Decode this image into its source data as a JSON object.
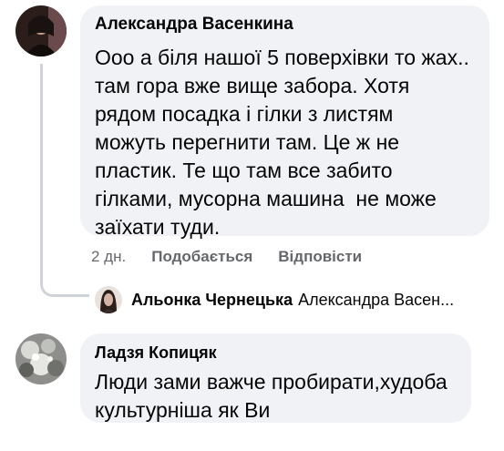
{
  "comments": [
    {
      "author": "Александра Васенкина",
      "lines": [
        "Ооо а біля нашої 5 поверхівки то жах..",
        "там гора вже вище забора. Хотя",
        "рядом посадка і гілки з листям",
        "можуть перегнити там. Це ж не",
        "пластик. Те що там все забито",
        "гілками, мусорна машина  не може",
        "заїхати туди."
      ],
      "meta": {
        "time": "2 дн.",
        "like_label": "Подобається",
        "reply_label": "Відповісти"
      }
    },
    {
      "author": "Ладзя Копицяк",
      "lines": [
        "Люди зами важче пробирати,худоба",
        "культурніша як Ви"
      ]
    }
  ],
  "reply_preview": {
    "author": "Альонка Чернецька",
    "text": "Александра Васен..."
  },
  "colors": {
    "bubble": "#f0f2f5",
    "text": "#050505",
    "secondary": "#65676b",
    "thread_line": "#d0d3d8"
  }
}
